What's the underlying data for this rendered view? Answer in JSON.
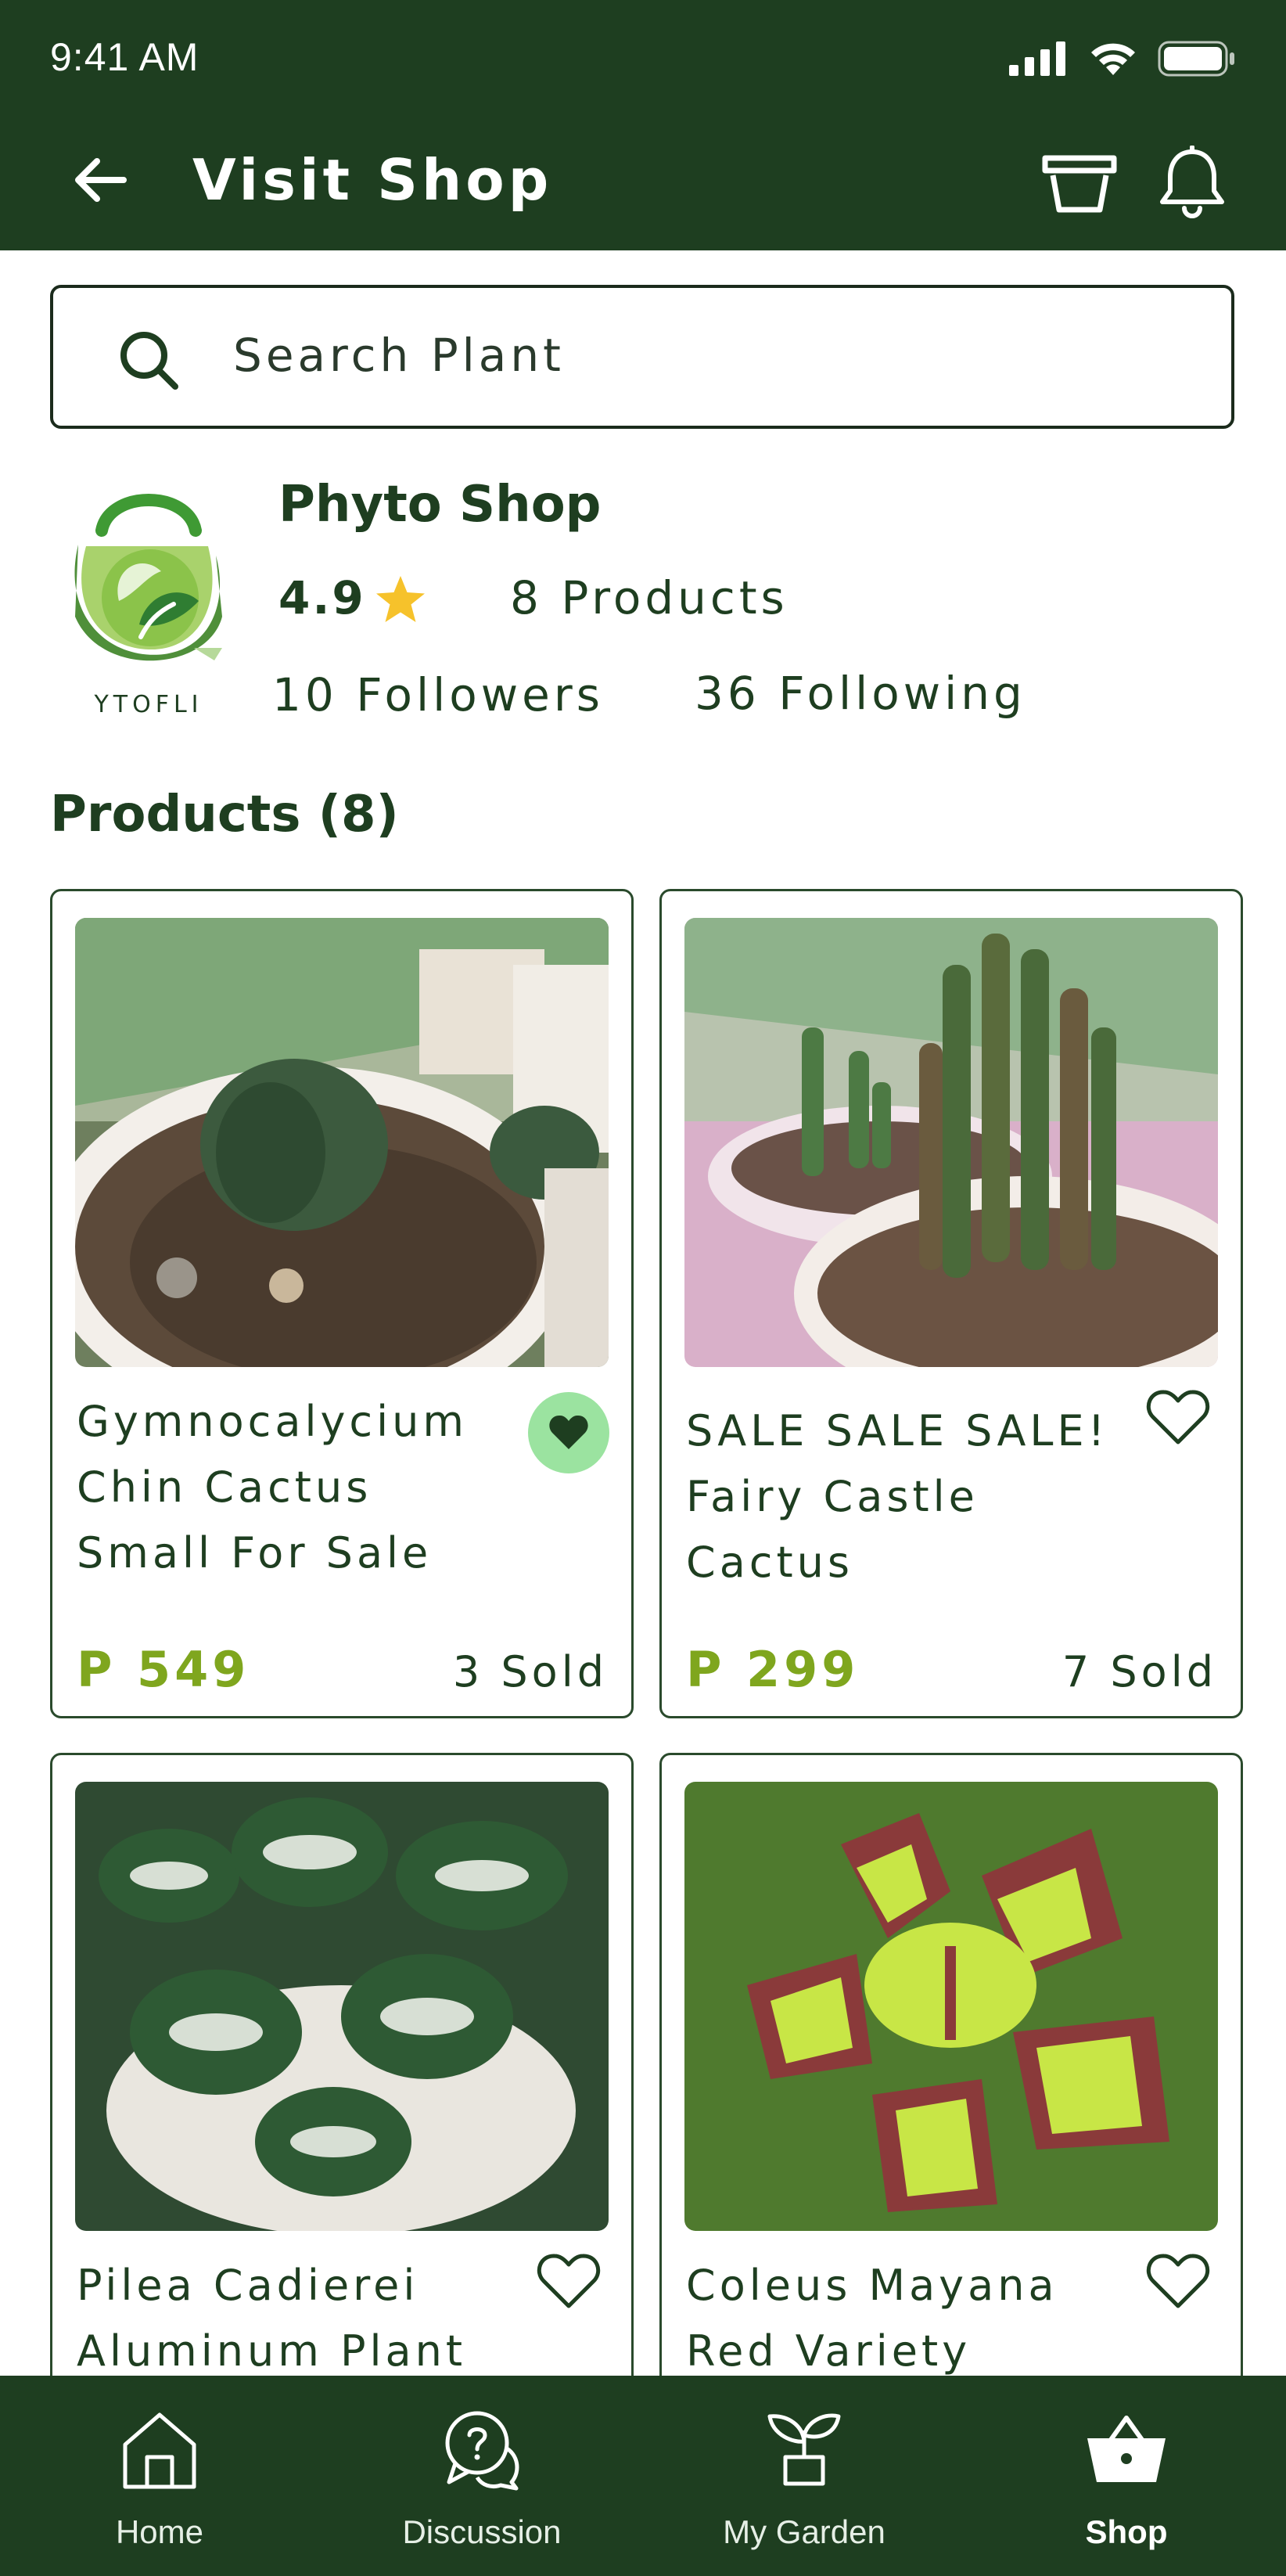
{
  "status_bar": {
    "time": "9:41 AM"
  },
  "header": {
    "title": "Visit Shop"
  },
  "search": {
    "placeholder": "Search Plant"
  },
  "shop": {
    "logo_text": "YTOFLI",
    "name": "Phyto Shop",
    "rating": "4.9",
    "products_count": "8 Products",
    "followers": "10 Followers",
    "following": "36 Following"
  },
  "products_section": {
    "title": "Products (8)"
  },
  "products": [
    {
      "title": "Gymnocalycium Chin Cactus Small For Sale",
      "price": "P 549",
      "sold": "3 Sold",
      "favorited": true
    },
    {
      "title": "SALE SALE SALE! Fairy Castle Cactus",
      "price": "P 299",
      "sold": "7 Sold",
      "favorited": false
    },
    {
      "title": "Pilea Cadierei Aluminum Plant",
      "price": "",
      "sold": "",
      "favorited": false
    },
    {
      "title": "Coleus Mayana Red Variety",
      "price": "",
      "sold": "",
      "favorited": false
    }
  ],
  "bottom_nav": {
    "items": [
      {
        "label": "Home",
        "icon": "home-icon",
        "active": false
      },
      {
        "label": "Discussion",
        "icon": "discussion-icon",
        "active": false
      },
      {
        "label": "My Garden",
        "icon": "plant-pot-icon",
        "active": false
      },
      {
        "label": "Shop",
        "icon": "shopping-basket-icon",
        "active": true
      }
    ]
  },
  "colors": {
    "primary_dark": "#1e3e20",
    "price_green": "#7fa61e",
    "favorite_bg": "#9be3a0",
    "star": "#f6c22b"
  }
}
